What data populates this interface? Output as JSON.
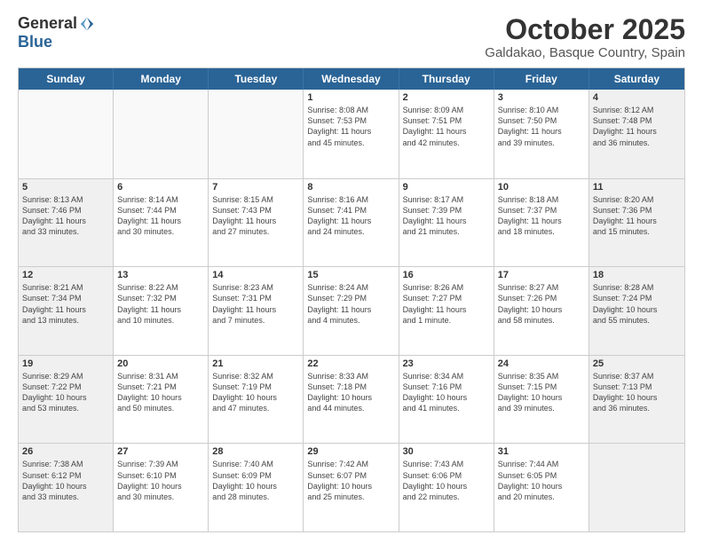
{
  "logo": {
    "general": "General",
    "blue": "Blue"
  },
  "title": "October 2025",
  "location": "Galdakao, Basque Country, Spain",
  "headers": [
    "Sunday",
    "Monday",
    "Tuesday",
    "Wednesday",
    "Thursday",
    "Friday",
    "Saturday"
  ],
  "rows": [
    [
      {
        "day": "",
        "text": "",
        "empty": true
      },
      {
        "day": "",
        "text": "",
        "empty": true
      },
      {
        "day": "",
        "text": "",
        "empty": true
      },
      {
        "day": "1",
        "text": "Sunrise: 8:08 AM\nSunset: 7:53 PM\nDaylight: 11 hours\nand 45 minutes.",
        "empty": false
      },
      {
        "day": "2",
        "text": "Sunrise: 8:09 AM\nSunset: 7:51 PM\nDaylight: 11 hours\nand 42 minutes.",
        "empty": false
      },
      {
        "day": "3",
        "text": "Sunrise: 8:10 AM\nSunset: 7:50 PM\nDaylight: 11 hours\nand 39 minutes.",
        "empty": false
      },
      {
        "day": "4",
        "text": "Sunrise: 8:12 AM\nSunset: 7:48 PM\nDaylight: 11 hours\nand 36 minutes.",
        "empty": false,
        "shaded": true
      }
    ],
    [
      {
        "day": "5",
        "text": "Sunrise: 8:13 AM\nSunset: 7:46 PM\nDaylight: 11 hours\nand 33 minutes.",
        "empty": false,
        "shaded": true
      },
      {
        "day": "6",
        "text": "Sunrise: 8:14 AM\nSunset: 7:44 PM\nDaylight: 11 hours\nand 30 minutes.",
        "empty": false
      },
      {
        "day": "7",
        "text": "Sunrise: 8:15 AM\nSunset: 7:43 PM\nDaylight: 11 hours\nand 27 minutes.",
        "empty": false
      },
      {
        "day": "8",
        "text": "Sunrise: 8:16 AM\nSunset: 7:41 PM\nDaylight: 11 hours\nand 24 minutes.",
        "empty": false
      },
      {
        "day": "9",
        "text": "Sunrise: 8:17 AM\nSunset: 7:39 PM\nDaylight: 11 hours\nand 21 minutes.",
        "empty": false
      },
      {
        "day": "10",
        "text": "Sunrise: 8:18 AM\nSunset: 7:37 PM\nDaylight: 11 hours\nand 18 minutes.",
        "empty": false
      },
      {
        "day": "11",
        "text": "Sunrise: 8:20 AM\nSunset: 7:36 PM\nDaylight: 11 hours\nand 15 minutes.",
        "empty": false,
        "shaded": true
      }
    ],
    [
      {
        "day": "12",
        "text": "Sunrise: 8:21 AM\nSunset: 7:34 PM\nDaylight: 11 hours\nand 13 minutes.",
        "empty": false,
        "shaded": true
      },
      {
        "day": "13",
        "text": "Sunrise: 8:22 AM\nSunset: 7:32 PM\nDaylight: 11 hours\nand 10 minutes.",
        "empty": false
      },
      {
        "day": "14",
        "text": "Sunrise: 8:23 AM\nSunset: 7:31 PM\nDaylight: 11 hours\nand 7 minutes.",
        "empty": false
      },
      {
        "day": "15",
        "text": "Sunrise: 8:24 AM\nSunset: 7:29 PM\nDaylight: 11 hours\nand 4 minutes.",
        "empty": false
      },
      {
        "day": "16",
        "text": "Sunrise: 8:26 AM\nSunset: 7:27 PM\nDaylight: 11 hours\nand 1 minute.",
        "empty": false
      },
      {
        "day": "17",
        "text": "Sunrise: 8:27 AM\nSunset: 7:26 PM\nDaylight: 10 hours\nand 58 minutes.",
        "empty": false
      },
      {
        "day": "18",
        "text": "Sunrise: 8:28 AM\nSunset: 7:24 PM\nDaylight: 10 hours\nand 55 minutes.",
        "empty": false,
        "shaded": true
      }
    ],
    [
      {
        "day": "19",
        "text": "Sunrise: 8:29 AM\nSunset: 7:22 PM\nDaylight: 10 hours\nand 53 minutes.",
        "empty": false,
        "shaded": true
      },
      {
        "day": "20",
        "text": "Sunrise: 8:31 AM\nSunset: 7:21 PM\nDaylight: 10 hours\nand 50 minutes.",
        "empty": false
      },
      {
        "day": "21",
        "text": "Sunrise: 8:32 AM\nSunset: 7:19 PM\nDaylight: 10 hours\nand 47 minutes.",
        "empty": false
      },
      {
        "day": "22",
        "text": "Sunrise: 8:33 AM\nSunset: 7:18 PM\nDaylight: 10 hours\nand 44 minutes.",
        "empty": false
      },
      {
        "day": "23",
        "text": "Sunrise: 8:34 AM\nSunset: 7:16 PM\nDaylight: 10 hours\nand 41 minutes.",
        "empty": false
      },
      {
        "day": "24",
        "text": "Sunrise: 8:35 AM\nSunset: 7:15 PM\nDaylight: 10 hours\nand 39 minutes.",
        "empty": false
      },
      {
        "day": "25",
        "text": "Sunrise: 8:37 AM\nSunset: 7:13 PM\nDaylight: 10 hours\nand 36 minutes.",
        "empty": false,
        "shaded": true
      }
    ],
    [
      {
        "day": "26",
        "text": "Sunrise: 7:38 AM\nSunset: 6:12 PM\nDaylight: 10 hours\nand 33 minutes.",
        "empty": false,
        "shaded": true
      },
      {
        "day": "27",
        "text": "Sunrise: 7:39 AM\nSunset: 6:10 PM\nDaylight: 10 hours\nand 30 minutes.",
        "empty": false
      },
      {
        "day": "28",
        "text": "Sunrise: 7:40 AM\nSunset: 6:09 PM\nDaylight: 10 hours\nand 28 minutes.",
        "empty": false
      },
      {
        "day": "29",
        "text": "Sunrise: 7:42 AM\nSunset: 6:07 PM\nDaylight: 10 hours\nand 25 minutes.",
        "empty": false
      },
      {
        "day": "30",
        "text": "Sunrise: 7:43 AM\nSunset: 6:06 PM\nDaylight: 10 hours\nand 22 minutes.",
        "empty": false
      },
      {
        "day": "31",
        "text": "Sunrise: 7:44 AM\nSunset: 6:05 PM\nDaylight: 10 hours\nand 20 minutes.",
        "empty": false
      },
      {
        "day": "",
        "text": "",
        "empty": true,
        "shaded": true
      }
    ]
  ]
}
